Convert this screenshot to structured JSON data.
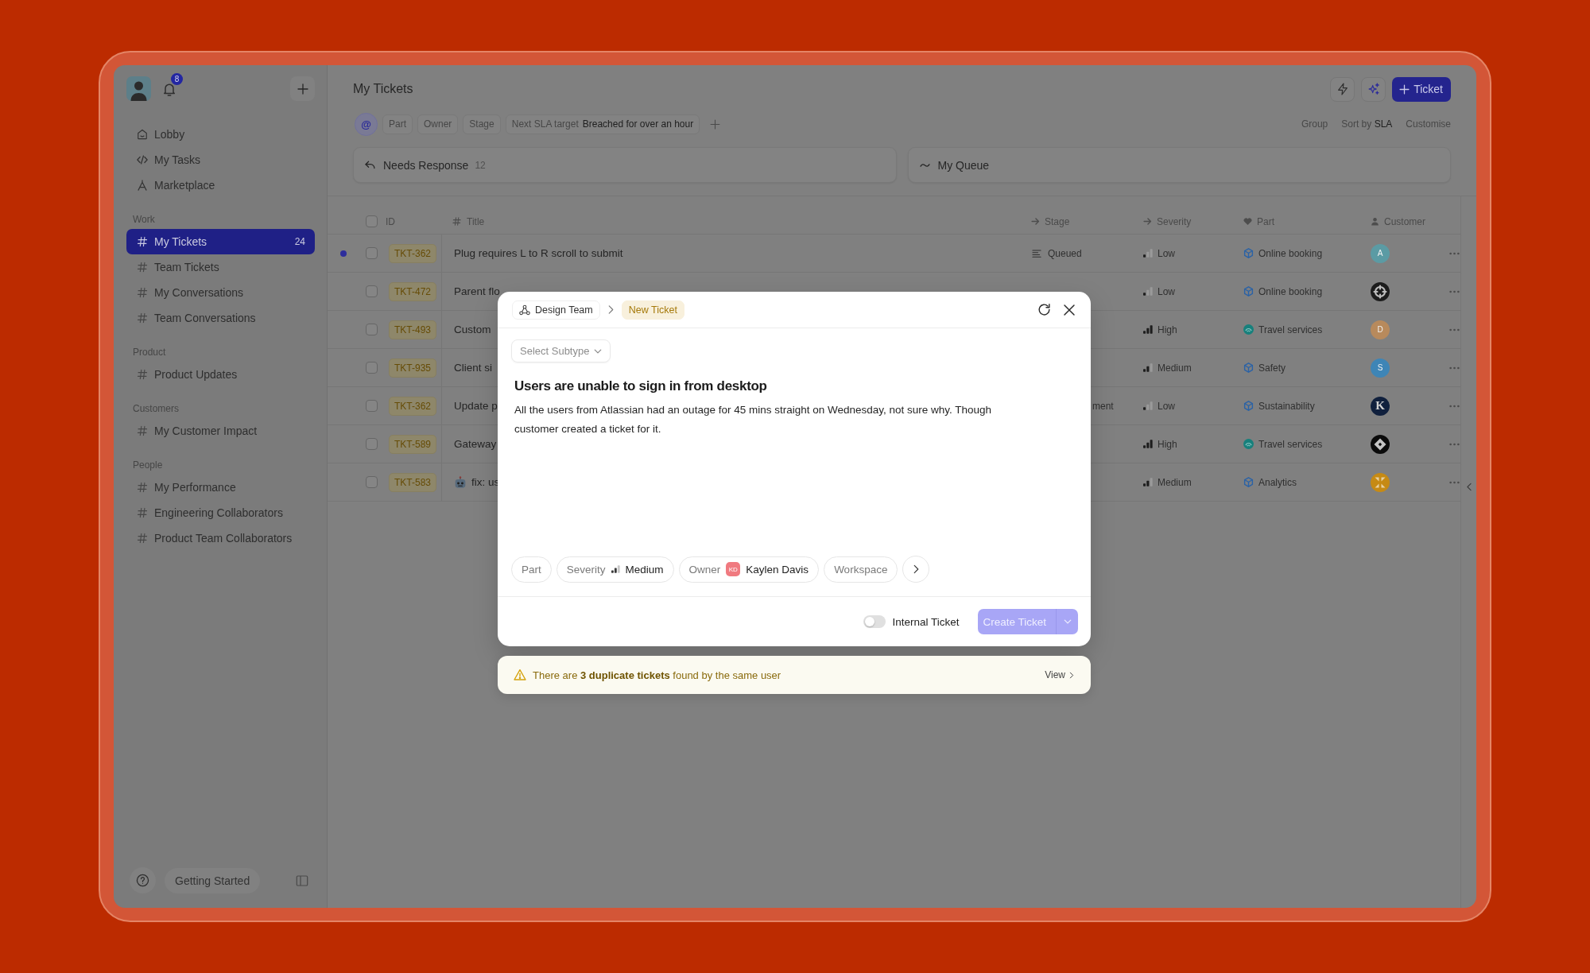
{
  "sidebar": {
    "notifications": "8",
    "nav": [
      {
        "kind": "home",
        "label": "Lobby"
      },
      {
        "kind": "code",
        "label": "My Tasks"
      },
      {
        "kind": "compass",
        "label": "Marketplace"
      }
    ],
    "sections": [
      {
        "title": "Work",
        "items": [
          {
            "label": "My Tickets",
            "count": "24",
            "selected": true
          },
          {
            "label": "Team Tickets",
            "selected": false
          },
          {
            "label": "My Conversations",
            "selected": false
          },
          {
            "label": "Team Conversations",
            "selected": false
          }
        ]
      },
      {
        "title": "Product",
        "items": [
          {
            "label": "Product Updates",
            "selected": false
          }
        ]
      },
      {
        "title": "Customers",
        "items": [
          {
            "label": "My Customer Impact",
            "selected": false
          }
        ]
      },
      {
        "title": "People",
        "items": [
          {
            "label": "My Performance",
            "selected": false
          },
          {
            "label": "Engineering Collaborators",
            "selected": false
          },
          {
            "label": "Product Team Collaborators",
            "selected": false
          }
        ]
      }
    ],
    "getting_started": "Getting Started"
  },
  "header": {
    "title": "My Tickets",
    "new_button": "Ticket"
  },
  "filters": {
    "mention": "@",
    "chips": [
      {
        "label": "Part"
      },
      {
        "label": "Owner"
      },
      {
        "label": "Stage"
      },
      {
        "label": "Next SLA target",
        "value": "Breached for over an hour"
      }
    ],
    "group": "Group",
    "sort": {
      "label": "Sort by",
      "value": "SLA"
    },
    "customise": "Customise"
  },
  "views": [
    {
      "kind": "reply",
      "label": "Needs Response",
      "count": "12"
    },
    {
      "kind": "queue",
      "label": "My Queue"
    }
  ],
  "table": {
    "all_checked": false,
    "columns": [
      {
        "kind": "id",
        "label": "ID"
      },
      {
        "kind": "hash",
        "label": "Title"
      },
      {
        "kind": "arrow",
        "label": "Stage"
      },
      {
        "kind": "arrow",
        "label": "Severity"
      },
      {
        "kind": "heart",
        "label": "Part"
      },
      {
        "kind": "person",
        "label": "Customer"
      }
    ],
    "rows": [
      {
        "unread": true,
        "checked": false,
        "id": "TKT-362",
        "title": {
          "kind": "plain",
          "text": "Plug requires L to R scroll to submit"
        },
        "stage": {
          "kind": "queued",
          "text": "Queued"
        },
        "severity": {
          "kind": "low",
          "text": "Low"
        },
        "part": {
          "kind": "cube",
          "text": "Online booking"
        },
        "customer": {
          "kind": "letter",
          "initial": "A",
          "color": "#5b9ba4"
        }
      },
      {
        "unread": false,
        "checked": false,
        "id": "TKT-472",
        "title": {
          "kind": "plain",
          "text": "Parent flo"
        },
        "severity": {
          "kind": "low",
          "text": "Low"
        },
        "part": {
          "kind": "cube",
          "text": "Online booking"
        },
        "customer": {
          "kind": "aperture",
          "color": "#1c1c1c"
        }
      },
      {
        "unread": false,
        "checked": false,
        "id": "TKT-493",
        "title": {
          "kind": "plain",
          "text": "Custom"
        },
        "severity": {
          "kind": "high",
          "text": "High"
        },
        "part": {
          "kind": "rings",
          "text": "Travel services"
        },
        "customer": {
          "kind": "letter",
          "initial": "D",
          "color": "#b88a5c"
        }
      },
      {
        "unread": false,
        "checked": false,
        "id": "TKT-935",
        "title": {
          "kind": "plain",
          "text": "Client si"
        },
        "severity": {
          "kind": "medium",
          "text": "Medium"
        },
        "part": {
          "kind": "cube",
          "text": "Safety"
        },
        "customer": {
          "kind": "letter",
          "initial": "S",
          "color": "#3e85b6"
        }
      },
      {
        "unread": false,
        "checked": false,
        "id": "TKT-362",
        "title": {
          "kind": "plain",
          "text": "Update p"
        },
        "stage": {
          "kind": "clipped",
          "text": "ment"
        },
        "severity": {
          "kind": "low",
          "text": "Low"
        },
        "part": {
          "kind": "cube",
          "text": "Sustainability"
        },
        "customer": {
          "kind": "monogram",
          "initial": "K",
          "color": "#10203d"
        }
      },
      {
        "unread": false,
        "checked": false,
        "id": "TKT-589",
        "title": {
          "kind": "plain",
          "text": "Gateway"
        },
        "severity": {
          "kind": "high",
          "text": "High"
        },
        "part": {
          "kind": "rings",
          "text": "Travel services"
        },
        "customer": {
          "kind": "diamond",
          "color": "#0b0b0b"
        }
      },
      {
        "unread": false,
        "checked": false,
        "id": "TKT-583",
        "title": {
          "kind": "robot",
          "text": "fix: us"
        },
        "severity": {
          "kind": "medium",
          "text": "Medium"
        },
        "part": {
          "kind": "cube",
          "text": "Analytics"
        },
        "customer": {
          "kind": "arrows",
          "color": "#c68a14"
        }
      }
    ]
  },
  "modal": {
    "breadcrumb": {
      "team": "Design Team",
      "current": "New Ticket"
    },
    "subtype": {
      "placeholder": "Select Subtype"
    },
    "title": "Users are unable to sign in from desktop",
    "description": "All the users from Atlassian had an outage for 45 mins straight on Wednesday, not sure why. Though customer created a ticket for it.",
    "fields": [
      {
        "kind": "plain",
        "label": "Part"
      },
      {
        "kind": "severity",
        "label": "Severity",
        "value": {
          "kind": "medium",
          "text": "Medium"
        }
      },
      {
        "kind": "owner",
        "label": "Owner",
        "initials": "KD",
        "value": "Kaylen Davis"
      },
      {
        "kind": "plain",
        "label": "Workspace"
      }
    ],
    "internal_ticket": {
      "label": "Internal Ticket",
      "on": false
    },
    "create_button": {
      "label": "Create Ticket",
      "disabled": true
    }
  },
  "warning": {
    "text": "There are **3 duplicate tickets** found by the same user",
    "action": "View"
  }
}
